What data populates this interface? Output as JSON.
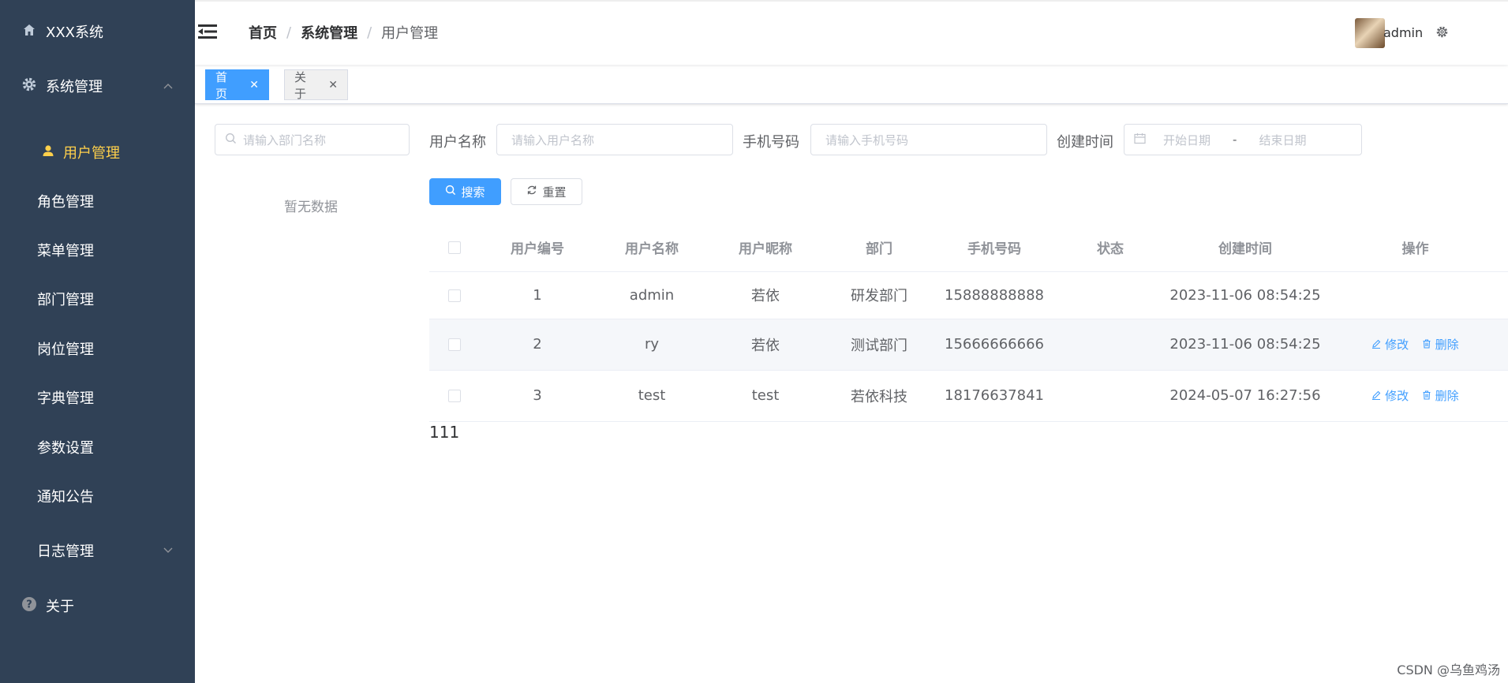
{
  "app": {
    "title": "XXX系统"
  },
  "sidebar": {
    "group": {
      "label": "系统管理"
    },
    "items": [
      {
        "label": "用户管理"
      },
      {
        "label": "角色管理"
      },
      {
        "label": "菜单管理"
      },
      {
        "label": "部门管理"
      },
      {
        "label": "岗位管理"
      },
      {
        "label": "字典管理"
      },
      {
        "label": "参数设置"
      },
      {
        "label": "通知公告"
      },
      {
        "label": "日志管理"
      }
    ],
    "about": {
      "label": "关于"
    }
  },
  "breadcrumb": [
    "首页",
    "系统管理",
    "用户管理"
  ],
  "user": {
    "name": "admin"
  },
  "tags": [
    {
      "label": "首页"
    },
    {
      "label": "关于"
    }
  ],
  "dept": {
    "placeholder": "请输入部门名称",
    "empty_text": "暂无数据"
  },
  "filters": {
    "username_label": "用户名称",
    "username_placeholder": "请输入用户名称",
    "phone_label": "手机号码",
    "phone_placeholder": "请输入手机号码",
    "created_label": "创建时间",
    "start_placeholder": "开始日期",
    "range_sep": "-",
    "end_placeholder": "结束日期",
    "search_label": "搜索",
    "reset_label": "重置"
  },
  "table": {
    "headers": [
      "用户编号",
      "用户名称",
      "用户昵称",
      "部门",
      "手机号码",
      "状态",
      "创建时间",
      "操作"
    ],
    "rows": [
      {
        "id": "1",
        "name": "admin",
        "nick": "若依",
        "dept": "研发部门",
        "phone": "15888888888",
        "status": "",
        "created": "2023-11-06 08:54:25",
        "ops": false
      },
      {
        "id": "2",
        "name": "ry",
        "nick": "若依",
        "dept": "测试部门",
        "phone": "15666666666",
        "status": "",
        "created": "2023-11-06 08:54:25",
        "ops": true
      },
      {
        "id": "3",
        "name": "test",
        "nick": "test",
        "dept": "若依科技",
        "phone": "18176637841",
        "status": "",
        "created": "2024-05-07 16:27:56",
        "ops": true
      }
    ],
    "edit_label": "修改",
    "delete_label": "删除"
  },
  "footnote": "111",
  "watermark": "CSDN @乌鱼鸡汤",
  "colors": {
    "sidebar": "#304156",
    "active": "#ffd04b",
    "primary": "#409eff"
  }
}
